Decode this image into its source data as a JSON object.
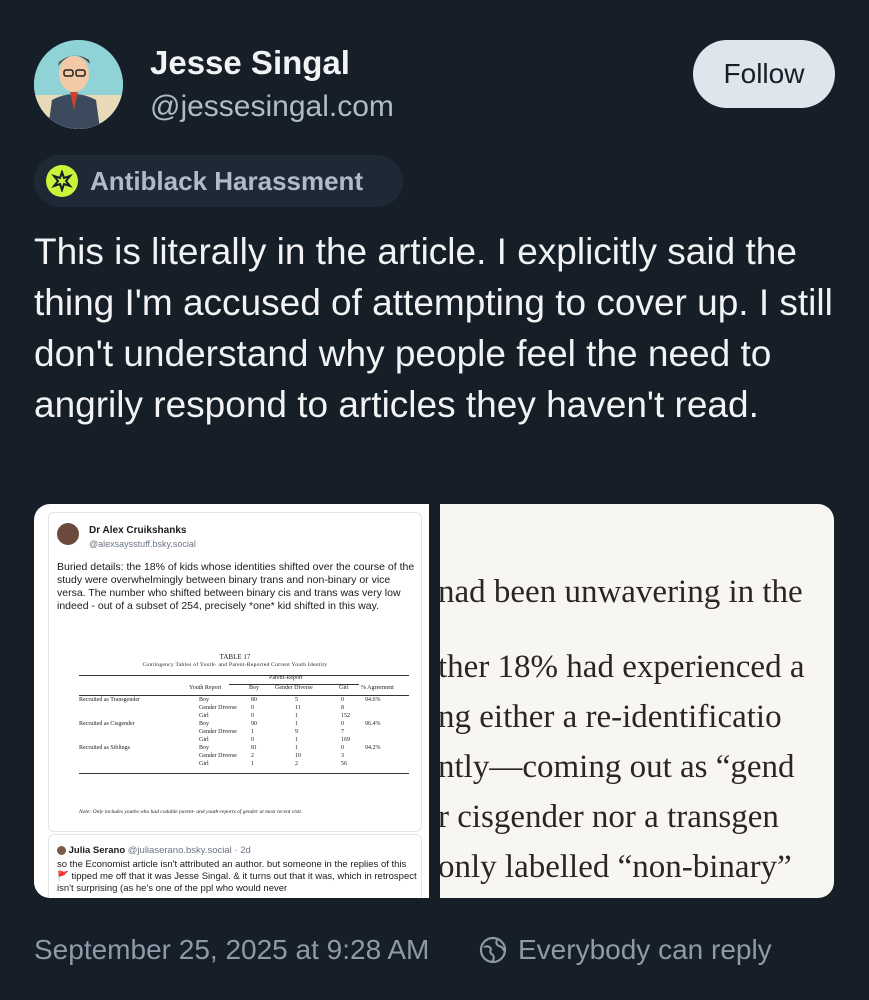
{
  "author": {
    "name": "Jesse Singal",
    "handle": "@jessesingal.com"
  },
  "follow_label": "Follow",
  "moderation_label": {
    "text": "Antiblack Harassment",
    "icon": "warning-badge-icon",
    "icon_color": "#c6f53a"
  },
  "post_text": "This is literally in the article. I explicitly said the thing I'm accused of attempting to cover up. I still don't understand why people feel the need to angrily respond to articles they haven't read.",
  "image1": {
    "quoted_post": {
      "author": "Dr Alex Cruikshanks",
      "handle": "@alexsaysstuff.bsky.social",
      "text": "Buried details: the 18% of kids whose identities shifted over the course of the study were overwhelmingly between binary trans and non-binary or vice versa. The number who shifted between binary cis and trans was very low indeed - out of a subset of 254, precisely *one* kid shifted in this way."
    },
    "table": {
      "title": "TABLE 17",
      "subtitle": "Contingency Tables of Youth- and Parent-Reported Current Youth Identity",
      "parent_header": "Parent-Report",
      "headers": [
        "Youth Report",
        "Boy",
        "Gender Diverse",
        "Girl",
        "% Agreement"
      ],
      "rows": [
        {
          "group": "Recruited as Transgender",
          "label": "Boy",
          "boy": "80",
          "gd": "5",
          "girl": "0",
          "agree": "94.6%"
        },
        {
          "group": "",
          "label": "Gender Diverse",
          "boy": "0",
          "gd": "11",
          "girl": "8",
          "agree": ""
        },
        {
          "group": "",
          "label": "Girl",
          "boy": "0",
          "gd": "1",
          "girl": "152",
          "agree": ""
        },
        {
          "group": "Recruited as Cisgender",
          "label": "Boy",
          "boy": "90",
          "gd": "1",
          "girl": "0",
          "agree": "96.4%"
        },
        {
          "group": "",
          "label": "Gender Diverse",
          "boy": "1",
          "gd": "9",
          "girl": "7",
          "agree": ""
        },
        {
          "group": "",
          "label": "Girl",
          "boy": "0",
          "gd": "1",
          "girl": "169",
          "agree": ""
        },
        {
          "group": "Recruited as Siblings",
          "label": "Boy",
          "boy": "81",
          "gd": "1",
          "girl": "0",
          "agree": "94.2%"
        },
        {
          "group": "",
          "label": "Gender Diverse",
          "boy": "2",
          "gd": "10",
          "girl": "3",
          "agree": ""
        },
        {
          "group": "",
          "label": "Girl",
          "boy": "1",
          "gd": "2",
          "girl": "56",
          "agree": ""
        }
      ],
      "note": "Note: Only includes youths who had codable parent- and youth-reports of gender at most recent visit."
    },
    "reply": {
      "author": "Julia Serano",
      "handle": "@juliaserano.bsky.social · 2d",
      "text": "so the Economist article isn't attributed an author. but someone in the replies of this 🚩 tipped me off that it was Jesse Singal. & it turns out that it was, which in retrospect isn't surprising (as he's one of the ppl who would never"
    }
  },
  "image2": {
    "lines": [
      "nad been unwavering in the",
      "ther 18% had experienced a",
      "ng either a re-identificatio",
      "ntly—coming out as “gend",
      "r cisgender nor a transgen",
      "only labelled “non-binary”"
    ]
  },
  "footer": {
    "timestamp": "September 25, 2025 at 9:28 AM",
    "reply_setting": "Everybody can reply",
    "reply_icon": "globe-icon"
  }
}
